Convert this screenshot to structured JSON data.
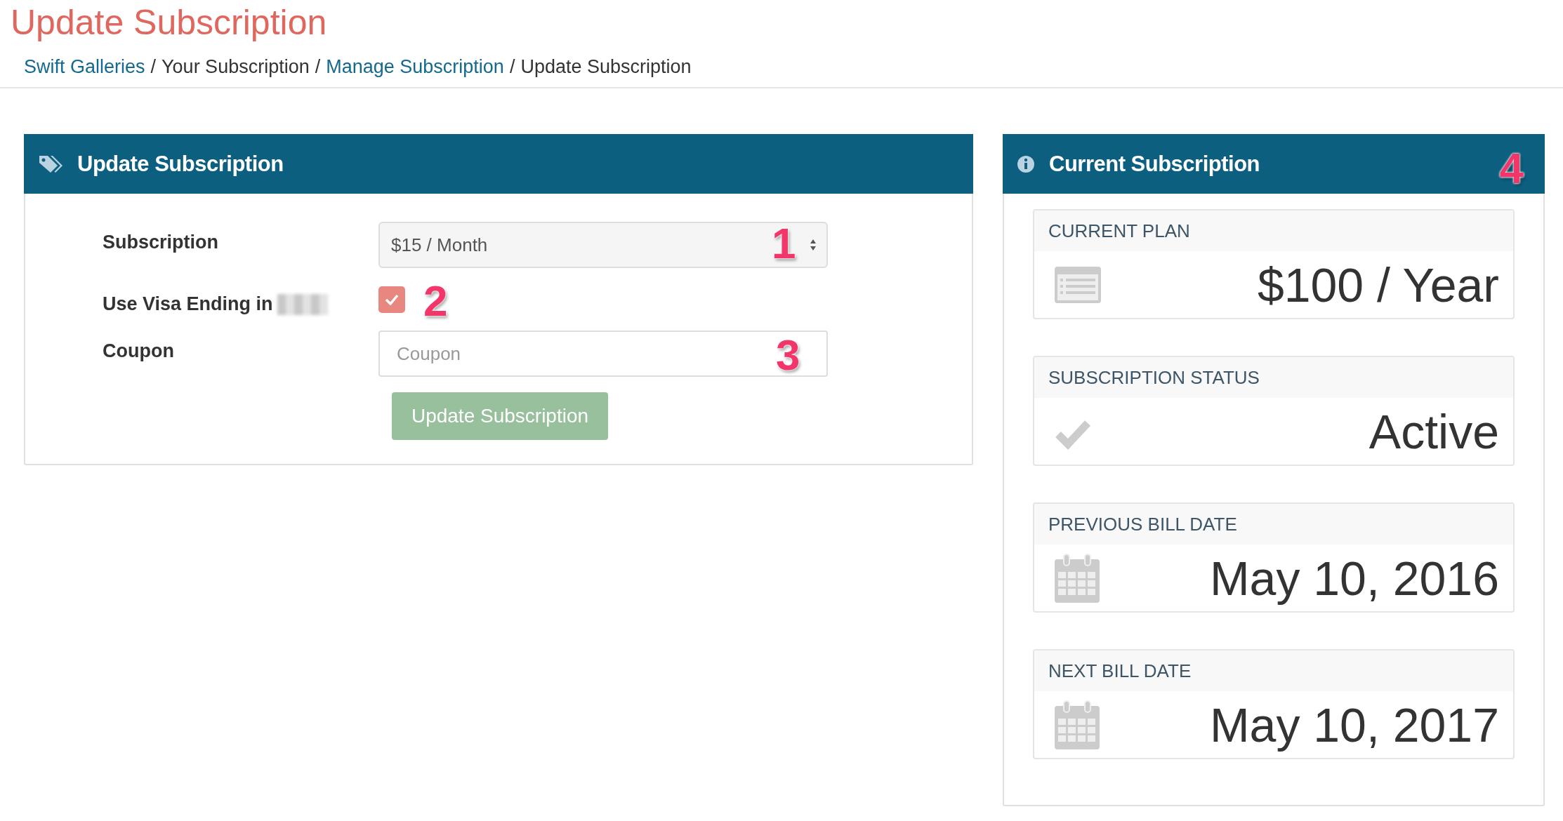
{
  "page_title": "Update Subscription",
  "breadcrumb": [
    {
      "label": "Swift Galleries",
      "kind": "link"
    },
    {
      "label": "/",
      "kind": "separator"
    },
    {
      "label": "Your Subscription",
      "kind": "text"
    },
    {
      "label": "/",
      "kind": "separator"
    },
    {
      "label": "Manage Subscription",
      "kind": "link"
    },
    {
      "label": "/",
      "kind": "separator"
    },
    {
      "label": "Update Subscription",
      "kind": "text"
    }
  ],
  "update_panel": {
    "title": "Update Subscription",
    "fields": [
      {
        "kind": "select",
        "label": "Subscription",
        "value": "$15 / Month"
      },
      {
        "kind": "checkbox",
        "label": "Use Visa Ending in",
        "redacted": true,
        "checked": true
      },
      {
        "kind": "input",
        "label": "Coupon",
        "placeholder": "Coupon"
      }
    ],
    "button": "Update Subscription"
  },
  "current_panel": {
    "title": "Current Subscription",
    "cards": [
      {
        "label": "CURRENT PLAN",
        "value": "$100 / Year",
        "kind": "plan"
      },
      {
        "label": "SUBSCRIPTION STATUS",
        "value": "Active",
        "kind": "status"
      },
      {
        "label": "PREVIOUS BILL DATE",
        "value": "May 10, 2016",
        "kind": "date"
      },
      {
        "label": "NEXT BILL DATE",
        "value": "May 10, 2017",
        "kind": "date"
      }
    ]
  },
  "callouts": [
    "1",
    "2",
    "3",
    "4"
  ]
}
